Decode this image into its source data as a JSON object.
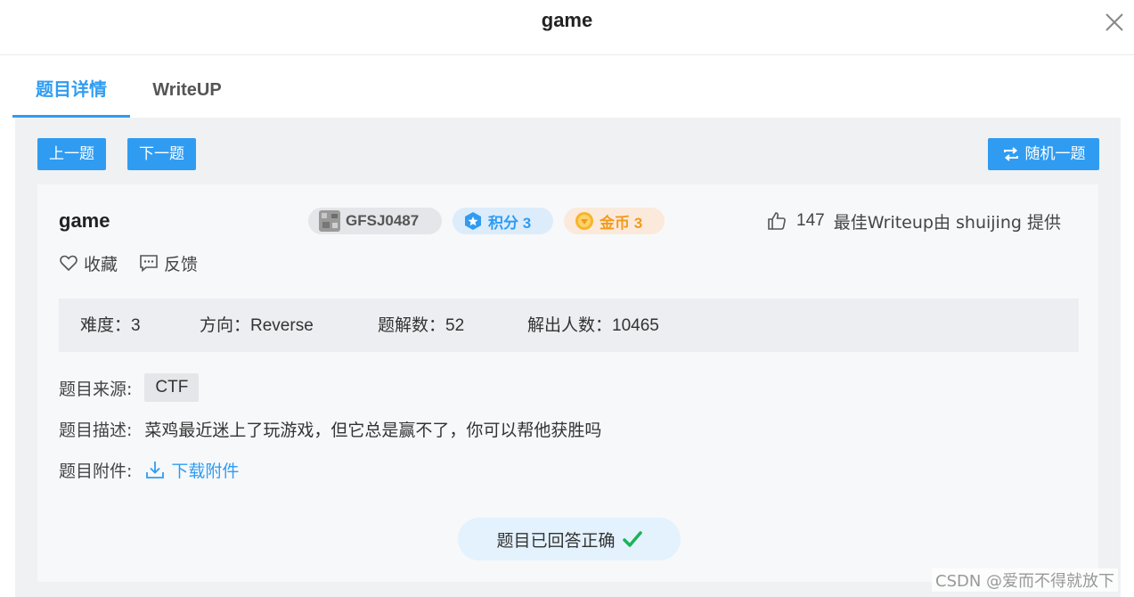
{
  "header": {
    "title": "game"
  },
  "tabs": [
    {
      "label": "题目详情",
      "active": true
    },
    {
      "label": "WriteUP",
      "active": false
    }
  ],
  "toolbar": {
    "prev_label": "上一题",
    "next_label": "下一题",
    "random_label": "随机一题"
  },
  "challenge": {
    "name": "game",
    "id": "GFSJ0487",
    "score_label": "积分 3",
    "coin_label": "金币 3",
    "likes": "147",
    "best_writeup": "最佳Writeup由 shuijing 提供",
    "favorite_label": "收藏",
    "feedback_label": "反馈"
  },
  "stats": {
    "difficulty_label": "难度：",
    "difficulty_value": "3",
    "direction_label": "方向：",
    "direction_value": "Reverse",
    "solutions_label": "题解数：",
    "solutions_value": "52",
    "solvers_label": "解出人数：",
    "solvers_value": "10465"
  },
  "details": {
    "source_label": "题目来源:",
    "source_value": "CTF",
    "desc_label": "题目描述:",
    "desc_value": "菜鸡最近迷上了玩游戏，但它总是赢不了，你可以帮他获胜吗",
    "attach_label": "题目附件:",
    "attach_link": "下载附件"
  },
  "status": {
    "answered_label": "题目已回答正确"
  },
  "watermark": "CSDN @爱而不得就放下",
  "colors": {
    "accent": "#2f9cf2",
    "coin": "#f29a1c",
    "success": "#1ab35a"
  }
}
